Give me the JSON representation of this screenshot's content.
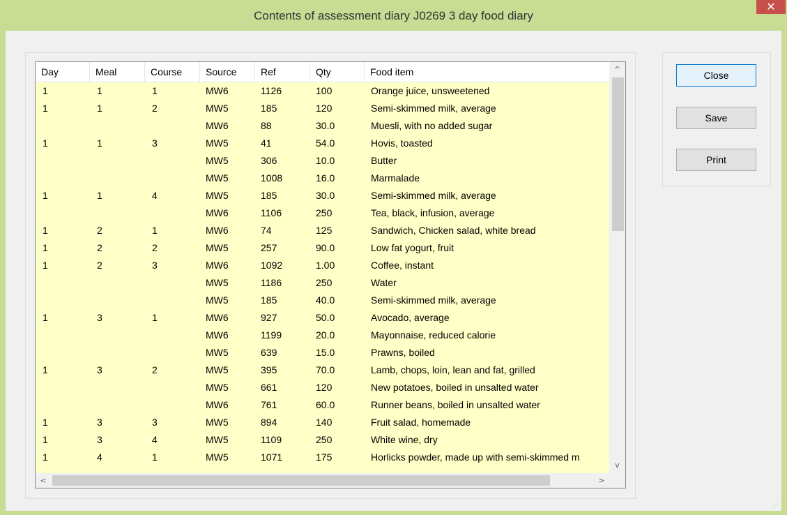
{
  "window": {
    "title": "Contents of assessment diary J0269 3 day food diary",
    "close_glyph": "✕"
  },
  "table": {
    "columns": [
      "Day",
      "Meal",
      "Course",
      "Source",
      "Ref",
      "Qty",
      "Food item"
    ],
    "rows": [
      {
        "day": "1",
        "meal": "1",
        "course": "1",
        "source": "MW6",
        "ref": "1126",
        "qty": "100",
        "food": "Orange juice, unsweetened"
      },
      {
        "day": "1",
        "meal": "1",
        "course": "2",
        "source": "MW5",
        "ref": "185",
        "qty": "120",
        "food": "Semi-skimmed milk, average"
      },
      {
        "day": "",
        "meal": "",
        "course": "",
        "source": "MW6",
        "ref": "88",
        "qty": "30.0",
        "food": "Muesli, with no added sugar"
      },
      {
        "day": "1",
        "meal": "1",
        "course": "3",
        "source": "MW5",
        "ref": "41",
        "qty": "54.0",
        "food": "Hovis, toasted"
      },
      {
        "day": "",
        "meal": "",
        "course": "",
        "source": "MW5",
        "ref": "306",
        "qty": "10.0",
        "food": "Butter"
      },
      {
        "day": "",
        "meal": "",
        "course": "",
        "source": "MW5",
        "ref": "1008",
        "qty": "16.0",
        "food": "Marmalade"
      },
      {
        "day": "1",
        "meal": "1",
        "course": "4",
        "source": "MW5",
        "ref": "185",
        "qty": "30.0",
        "food": "Semi-skimmed milk, average"
      },
      {
        "day": "",
        "meal": "",
        "course": "",
        "source": "MW6",
        "ref": "1106",
        "qty": "250",
        "food": "Tea, black, infusion, average"
      },
      {
        "day": "1",
        "meal": "2",
        "course": "1",
        "source": "MW6",
        "ref": "74",
        "qty": "125",
        "food": "Sandwich, Chicken salad, white bread"
      },
      {
        "day": "1",
        "meal": "2",
        "course": "2",
        "source": "MW5",
        "ref": "257",
        "qty": "90.0",
        "food": "Low fat yogurt, fruit"
      },
      {
        "day": "1",
        "meal": "2",
        "course": "3",
        "source": "MW6",
        "ref": "1092",
        "qty": "1.00",
        "food": "Coffee, instant"
      },
      {
        "day": "",
        "meal": "",
        "course": "",
        "source": "MW5",
        "ref": "1186",
        "qty": "250",
        "food": "Water"
      },
      {
        "day": "",
        "meal": "",
        "course": "",
        "source": "MW5",
        "ref": "185",
        "qty": "40.0",
        "food": "Semi-skimmed milk, average"
      },
      {
        "day": "1",
        "meal": "3",
        "course": "1",
        "source": "MW6",
        "ref": "927",
        "qty": "50.0",
        "food": "Avocado, average"
      },
      {
        "day": "",
        "meal": "",
        "course": "",
        "source": "MW6",
        "ref": "1199",
        "qty": "20.0",
        "food": "Mayonnaise, reduced calorie"
      },
      {
        "day": "",
        "meal": "",
        "course": "",
        "source": "MW5",
        "ref": "639",
        "qty": "15.0",
        "food": "Prawns, boiled"
      },
      {
        "day": "1",
        "meal": "3",
        "course": "2",
        "source": "MW5",
        "ref": "395",
        "qty": "70.0",
        "food": "Lamb, chops, loin, lean and fat, grilled"
      },
      {
        "day": "",
        "meal": "",
        "course": "",
        "source": "MW5",
        "ref": "661",
        "qty": "120",
        "food": "New potatoes, boiled in unsalted water"
      },
      {
        "day": "",
        "meal": "",
        "course": "",
        "source": "MW6",
        "ref": "761",
        "qty": "60.0",
        "food": "Runner beans, boiled in unsalted water"
      },
      {
        "day": "1",
        "meal": "3",
        "course": "3",
        "source": "MW5",
        "ref": "894",
        "qty": "140",
        "food": "Fruit salad, homemade"
      },
      {
        "day": "1",
        "meal": "3",
        "course": "4",
        "source": "MW5",
        "ref": "1109",
        "qty": "250",
        "food": "White wine, dry"
      },
      {
        "day": "1",
        "meal": "4",
        "course": "1",
        "source": "MW5",
        "ref": "1071",
        "qty": "175",
        "food": "Horlicks powder, made up with semi-skimmed m"
      }
    ]
  },
  "scrollbars": {
    "up_arrow": "^",
    "down_arrow": "v",
    "left_arrow": "<",
    "right_arrow": ">"
  },
  "buttons": {
    "close": "Close",
    "save": "Save",
    "print": "Print"
  },
  "colors": {
    "title_bar": "#c9dc93",
    "list_background": "#ffffc8",
    "close_button": "#c7504a"
  }
}
